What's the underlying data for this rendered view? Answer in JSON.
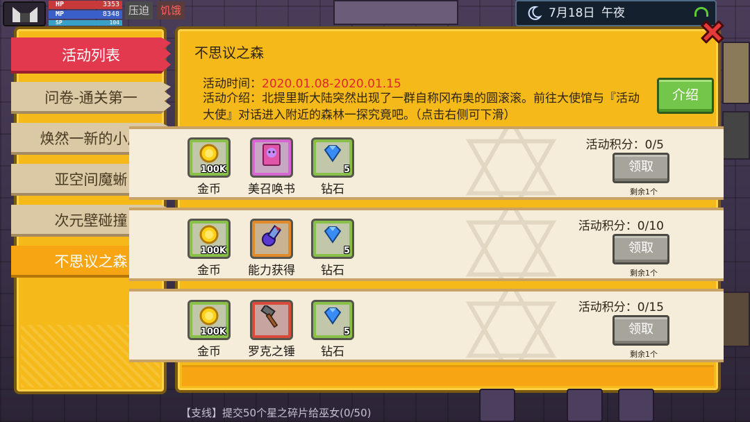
{
  "hud": {
    "hp_label": "HP",
    "hp_value": "3353",
    "mp_label": "MP",
    "mp_value": "8348",
    "sp_label": "SP",
    "sp_value": "104",
    "status_pressure": "压迫",
    "status_hunger": "饥饿"
  },
  "clock": {
    "date": "7月18日",
    "period": "午夜"
  },
  "sidebar": {
    "tabs": [
      {
        "label": "活动列表",
        "state": "header"
      },
      {
        "label": "问卷-通关第一",
        "state": "normal"
      },
      {
        "label": "焕然一新的小屋",
        "state": "normal"
      },
      {
        "label": "亚空间魔蜥",
        "state": "normal"
      },
      {
        "label": "次元壁碰撞",
        "state": "normal"
      },
      {
        "label": "不思议之森",
        "state": "selected"
      }
    ]
  },
  "panel": {
    "title": "不思议之森",
    "time_label": "活动时间：",
    "time_value": "2020.01.08-2020.01.15",
    "description": "活动介绍：北提里斯大陆突然出现了一群自称冈布奥的圆滚滚。前往大使馆与『活动大使』对话进入附近的森林一探究竟吧。（点击右侧可下滑）",
    "intro_button": "介绍",
    "rows": [
      {
        "rewards": [
          {
            "name": "金币",
            "qty": "100K",
            "icon": "gold-coin-icon",
            "frame": "green"
          },
          {
            "name": "美召唤书",
            "qty": "",
            "icon": "summon-book-icon",
            "frame": "pink"
          },
          {
            "name": "钻石",
            "qty": "5",
            "icon": "diamond-icon",
            "frame": "green"
          }
        ],
        "score": "活动积分：0/5",
        "claim": "领取",
        "remaining": "剩余1个"
      },
      {
        "rewards": [
          {
            "name": "金币",
            "qty": "100K",
            "icon": "gold-coin-icon",
            "frame": "green"
          },
          {
            "name": "能力获得",
            "qty": "",
            "icon": "ability-scroll-icon",
            "frame": "orange"
          },
          {
            "name": "钻石",
            "qty": "5",
            "icon": "diamond-icon",
            "frame": "green"
          }
        ],
        "score": "活动积分：0/10",
        "claim": "领取",
        "remaining": "剩余1个"
      },
      {
        "rewards": [
          {
            "name": "金币",
            "qty": "100K",
            "icon": "gold-coin-icon",
            "frame": "green"
          },
          {
            "name": "罗克之锤",
            "qty": "",
            "icon": "hammer-icon",
            "frame": "red"
          },
          {
            "name": "钻石",
            "qty": "5",
            "icon": "diamond-icon",
            "frame": "green"
          }
        ],
        "score": "活动积分：0/15",
        "claim": "领取",
        "remaining": "剩余1个"
      }
    ]
  },
  "quest": {
    "text": "【支线】提交50个星之碎片给巫女(0/50)"
  },
  "colors": {
    "panel_yellow": "#f5b91a",
    "tab_red": "#e2394f",
    "tab_selected": "#f7a513",
    "time_red": "#e0262b",
    "intro_green": "#74c64a",
    "close_red": "#e53a3a"
  }
}
